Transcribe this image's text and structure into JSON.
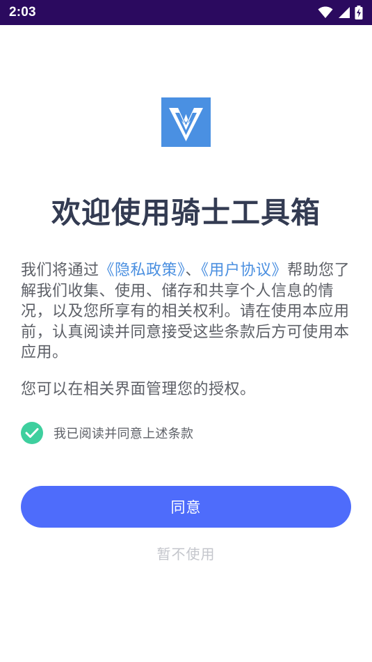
{
  "status_bar": {
    "time": "2:03",
    "icons": [
      "wifi-icon",
      "signal-icon",
      "battery-charging-icon"
    ],
    "background": "#2b0a5f"
  },
  "logo": {
    "icon": "knight-logo-icon",
    "color": "#4a90e2"
  },
  "title": "欢迎使用骑士工具箱",
  "body": {
    "intro_before": "我们将通过",
    "privacy_link": "《隐私政策》",
    "separator": "、",
    "terms_link": "《用户协议》",
    "intro_after": "帮助您了解我们收集、使用、储存和共享个人信息的情况，以及您所享有的相关权利。请在使用本应用前，认真阅读并同意接受这些条款后方可使用本应用。",
    "authorization_note": "您可以在相关界面管理您的授权。",
    "link_color": "#4a8fe0"
  },
  "consent": {
    "checked": true,
    "label": "我已阅读并同意上述条款",
    "check_color": "#3ecf9e"
  },
  "actions": {
    "agree_label": "同意",
    "decline_label": "暂不使用",
    "agree_color": "#4e6cfb"
  }
}
